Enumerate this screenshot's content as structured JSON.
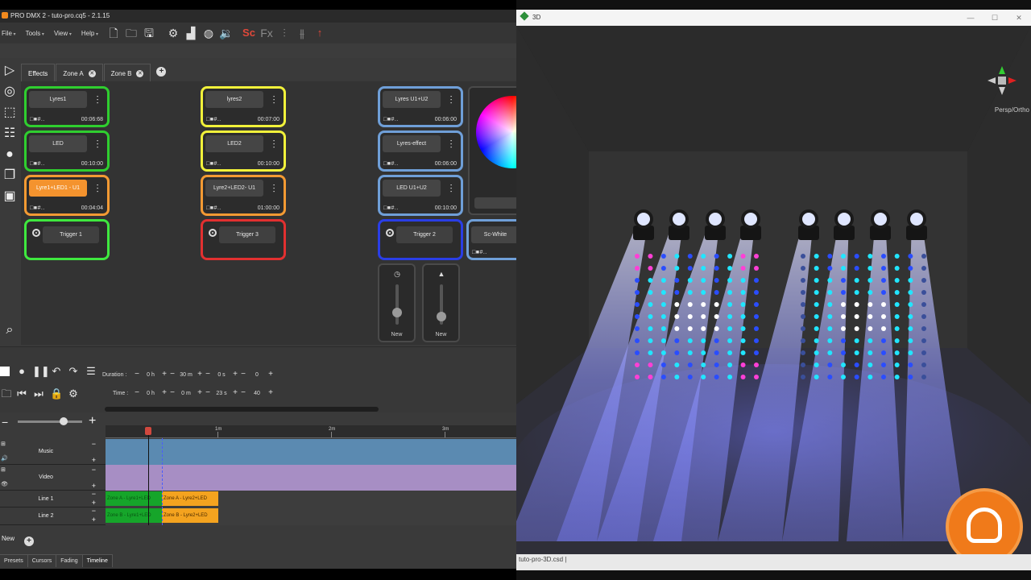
{
  "app": {
    "title": "PRO DMX 2 - tuto-pro.cq5 - 2.1.15",
    "menu": [
      "File",
      "Tools",
      "View",
      "Help"
    ],
    "toolbar_icons": [
      "new-file-icon",
      "open-folder-icon",
      "save-icon",
      "settings-icon",
      "chart-icon",
      "dmx-icon",
      "speaker-icon",
      "script-icon",
      "fx-icon",
      "sliders-icon",
      "sliders-alt-icon",
      "arrow-up-icon"
    ],
    "toolbar_text": {
      "script": "Sc",
      "fx": "Fx"
    },
    "tabs": [
      {
        "label": "Effects",
        "closable": false
      },
      {
        "label": "Zone A",
        "closable": true
      },
      {
        "label": "Zone B",
        "closable": true
      }
    ],
    "cards": [
      {
        "name": "Lyres1",
        "time": "00:06:68",
        "border": "#2fce2f"
      },
      {
        "name": "LED",
        "time": "00:10:00",
        "border": "#2fce2f"
      },
      {
        "name": "Lyre1+LED1 - U1",
        "time": "00:04:04",
        "border": "#f49a33",
        "highlight": true
      },
      {
        "name": "Trigger 1",
        "trigger": true,
        "border": "#3fe83f"
      },
      {
        "name": "lyres2",
        "time": "00:07:00",
        "border": "#f1f13a"
      },
      {
        "name": "LED2",
        "time": "00:10:00",
        "border": "#f1f13a"
      },
      {
        "name": "Lyre2+LED2- U1",
        "time": "01:00:00",
        "border": "#f49a33"
      },
      {
        "name": "Trigger 3",
        "trigger": true,
        "border": "#e23030"
      },
      {
        "name": "Lyres U1+U2",
        "time": "00:06:00",
        "border": "#6f9fd8"
      },
      {
        "name": "Lyres-effect",
        "time": "00:06:00",
        "border": "#6f9fd8"
      },
      {
        "name": "LED U1+U2",
        "time": "00:10:00",
        "border": "#6f9fd8"
      },
      {
        "name": "Trigger 2",
        "trigger": true,
        "border": "#2a3ee6"
      },
      {
        "name": "Sc-White",
        "trigger": false,
        "border": "#6f9fd8",
        "partial": true
      }
    ],
    "card_icons_text": "□■#..",
    "faders": [
      {
        "name": "New",
        "icon": "timer-icon",
        "level": 0.3
      },
      {
        "name": "New",
        "icon": "triangle-icon",
        "level": 0.2
      }
    ],
    "transport": {
      "duration_label": "Duration :",
      "duration": [
        "0 h",
        "30 m",
        "0 s",
        "0"
      ],
      "time_label": "Time :",
      "time": [
        "0 h",
        "0 m",
        "23 s",
        "40"
      ]
    },
    "ruler_ticks": [
      "1m",
      "2m",
      "3m"
    ],
    "tracks": [
      {
        "name": "Music",
        "color": "#5b8ab1"
      },
      {
        "name": "Video",
        "color": "#a78ec4"
      },
      {
        "name": "Line 1",
        "clips": [
          {
            "label": "Zone A - Lyre1+LED",
            "color": "#16a52a",
            "text": "#0a5414"
          },
          {
            "label": "Zone A - Lyre2+LED",
            "color": "#f4a31f",
            "text": "#4a2a00"
          }
        ]
      },
      {
        "name": "Line 2",
        "clips": [
          {
            "label": "Zone B - Lyre1+LED",
            "color": "#16a52a",
            "text": "#0a5414"
          },
          {
            "label": "Zone B - Lyre2+LED",
            "color": "#f4a31f",
            "text": "#4a2a00"
          }
        ]
      }
    ],
    "new_label": "New",
    "bottom_tabs": [
      "Presets",
      "Cursors",
      "Fading",
      "Timeline"
    ],
    "active_bottom_tab": "Timeline"
  },
  "viewer3d": {
    "title": "3D",
    "view_mode": "Persp/Ortho",
    "status": "tuto-pro-3D.csd |",
    "fixture_count": 8
  }
}
